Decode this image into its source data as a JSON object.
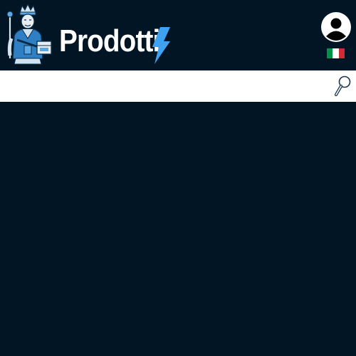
{
  "header": {
    "brand_title": "Prodotti",
    "logo_icon": "king-mascot-logo-icon",
    "bolt_icon": "lightning-bolt-icon",
    "accent_color": "#3fa2f0",
    "background_color": "#011524"
  },
  "user": {
    "avatar_icon": "user-avatar-icon"
  },
  "language": {
    "flag_icon": "italian-flag-icon",
    "colors": [
      "#009246",
      "#ffffff",
      "#ce2b37"
    ]
  },
  "search": {
    "placeholder": "",
    "value": "",
    "button_icon": "magnifier-icon"
  }
}
